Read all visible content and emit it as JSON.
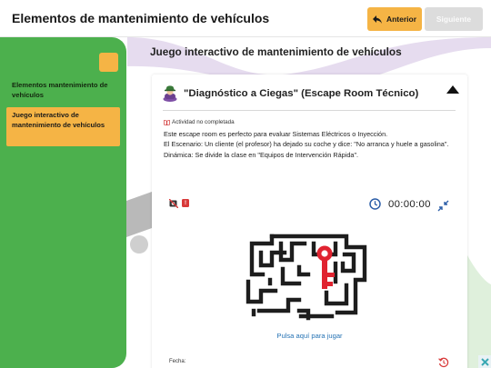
{
  "header": {
    "title": "Elementos de mantenimiento de vehículos",
    "prev_label": "Anterior",
    "next_label": "Siguiente",
    "prev_icon": "reply-arrow-icon"
  },
  "sidebar": {
    "items": [
      {
        "label": "Elementos mantenimiento de vehículos",
        "active": false
      },
      {
        "label": "Juego interactivo de mantenimiento de vehículos",
        "active": true
      }
    ]
  },
  "main": {
    "title": "Juego interactivo de mantenimiento de vehículos",
    "card": {
      "title": "\"Diagnóstico a Ciegas\" (Escape Room Técnico)",
      "status": "Actividad no completada",
      "description": [
        "Este escape room es perfecto para evaluar Sistemas Eléctricos o Inyección.",
        "El Escenario: Un cliente (el profesor) ha dejado su coche y dice: \"No arranca y huele a gasolina\".",
        "Dinámica: Se divide la clase en \"Equipos de Intervención Rápida\"."
      ],
      "timer": "00:00:00",
      "badge_mark": "!",
      "play_label": "Pulsa aquí para jugar",
      "date_label": "Fecha:"
    }
  },
  "colors": {
    "accent": "#f5b445",
    "sidebar": "#4cb04d",
    "link": "#2673b4",
    "alert": "#d83a3a",
    "clock": "#2d5fa8"
  }
}
